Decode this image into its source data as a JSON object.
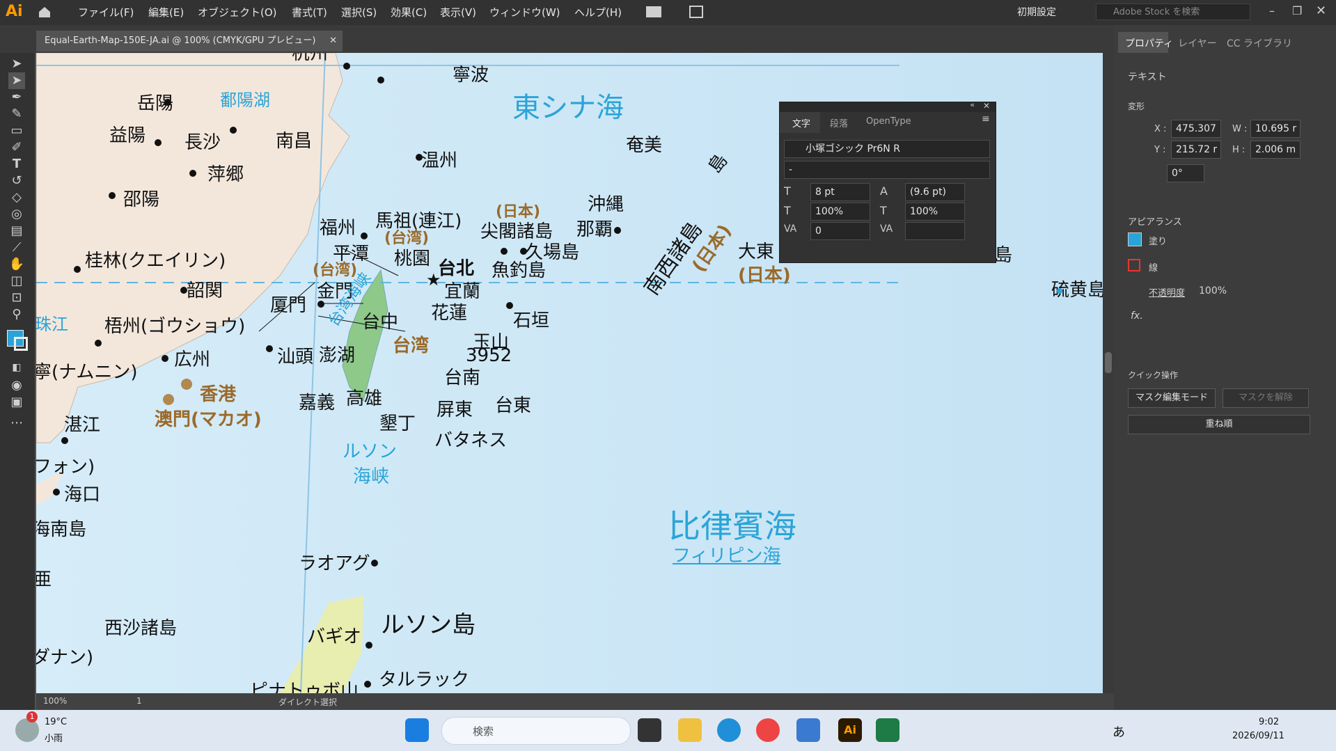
{
  "app": {
    "logo": "Ai"
  },
  "menu": [
    "ファイル(F)",
    "編集(E)",
    "オブジェクト(O)",
    "書式(T)",
    "選択(S)",
    "効果(C)",
    "表示(V)",
    "ウィンドウ(W)",
    "ヘルプ(H)"
  ],
  "workspace": "初期設定",
  "search_stock_placeholder": "Adobe Stock を検索",
  "doc_tab": "Equal-Earth-Map-150E-JA.ai @ 100% (CMYK/GPU プレビュー)",
  "map": {
    "places": [
      "杭州",
      "寧波",
      "岳陽",
      "鄱陽湖",
      "東シナ海",
      "益陽",
      "長沙",
      "南昌",
      "温州",
      "萍郷",
      "邵陽",
      "奄美",
      "福州",
      "馬祖(連江)",
      "(台湾)",
      "(日本)",
      "尖閣諸島",
      "沖縄",
      "那覇",
      "平潭",
      "桃園",
      "久場島",
      "桂林(クエイリン)",
      "(台湾)",
      "金門",
      "台北",
      "宜蘭",
      "魚釣島",
      "韶関",
      "厦門",
      "台湾海峡",
      "石垣",
      "大東",
      "(日本)",
      "南西諸島",
      "(日本)",
      "台中",
      "花蓮",
      "珠江",
      "梧州(ゴウショウ)",
      "玉山",
      "3952",
      "台湾",
      "広州",
      "汕頭",
      "澎湖",
      "寧(ナムニン)",
      "台南",
      "香港",
      "嘉義",
      "高雄",
      "台東",
      "屏東",
      "澳門(マカオ)",
      "湛江",
      "墾丁",
      "バタネス",
      "ルソン",
      "海峡",
      "フォン)",
      "海口",
      "海南島",
      "比律賓海",
      "フィリピン海",
      "ラオアグ",
      "亜",
      "ルソン島",
      "西沙諸島",
      "バギオ",
      "ダナン)",
      "タルラック",
      "ピナトゥボ山",
      "硫黄島",
      "島",
      "島"
    ]
  },
  "status": {
    "zoom": "100%",
    "page": "1",
    "tool": "ダイレクト選択"
  },
  "panel": {
    "tabs": [
      "プロパティ",
      "レイヤー",
      "CC ライブラリ"
    ],
    "section_text": "テキスト",
    "section_transform": "変形",
    "x": "475.307",
    "w": "10.695 r",
    "y": "215.72 r",
    "h": "2.006 m",
    "angle": "0°",
    "labels": {
      "x": "X :",
      "w": "W :",
      "y": "Y :",
      "h": "H :"
    },
    "section_appearance": "アピアランス",
    "fill": "塗り",
    "stroke": "線",
    "opacity_label": "不透明度",
    "opacity": "100%",
    "fx": "fx.",
    "section_quick": "クイック操作",
    "mask_edit": "マスク編集モード",
    "mask_release": "マスクを解除",
    "arrange": "重ね順"
  },
  "char_panel": {
    "tabs": [
      "文字",
      "段落",
      "OpenType"
    ],
    "font": "小塚ゴシック Pr6N R",
    "style": "-",
    "size": "8 pt",
    "leading": "(9.6 pt)",
    "vscale": "100%",
    "hscale": "100%",
    "tracking": "0",
    "kerning": ""
  },
  "taskbar": {
    "weather_temp": "19°C",
    "weather_desc": "小雨",
    "badge": "1",
    "search": "検索",
    "ime": "あ",
    "time": "9:02",
    "date": "2026/09/11"
  },
  "colors": {
    "accent": "#2aa4d8",
    "brown": "#9a6a2a",
    "land": "#f3e7dc",
    "taiwan": "#8ec98a"
  }
}
